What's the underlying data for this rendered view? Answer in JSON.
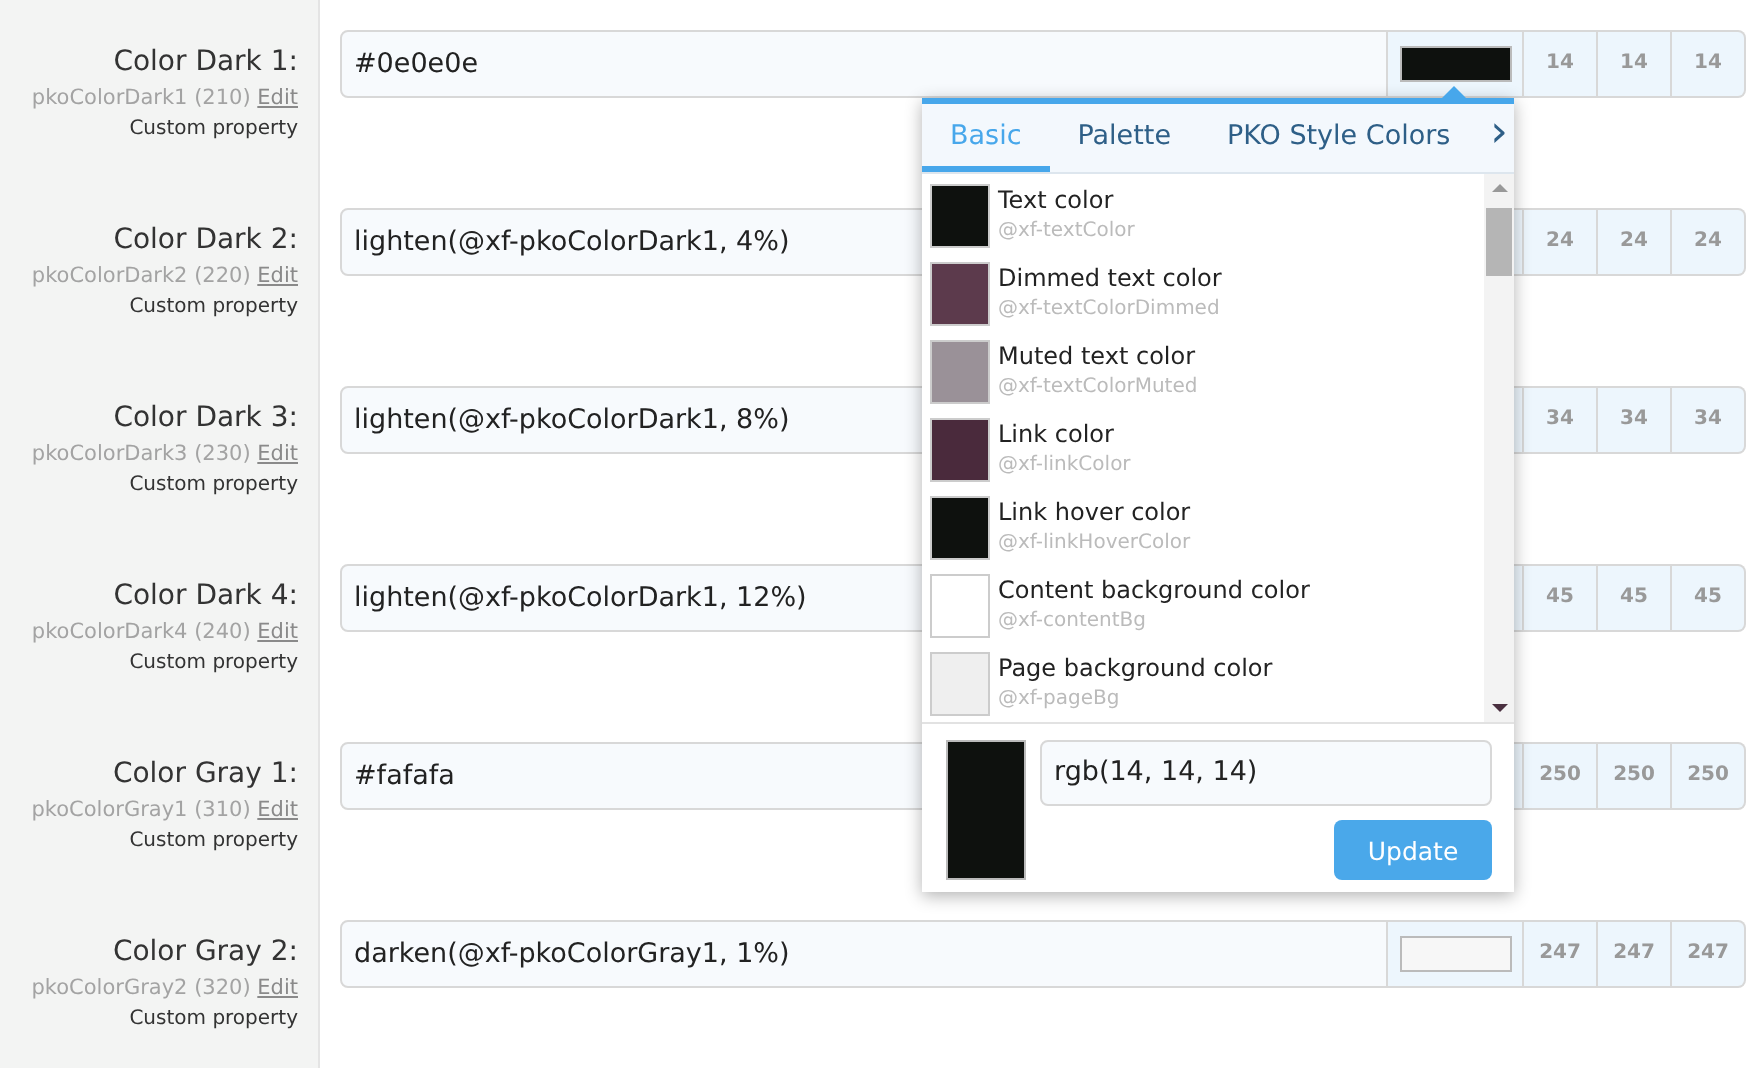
{
  "properties": [
    {
      "title": "Color Dark 1:",
      "name": "pkoColorDark1 (210)",
      "edit": "Edit",
      "note": "Custom property",
      "value": "#0e0e0e",
      "color": "#0e110e",
      "channels": [
        "14",
        "14",
        "14"
      ]
    },
    {
      "title": "Color Dark 2:",
      "name": "pkoColorDark2 (220)",
      "edit": "Edit",
      "note": "Custom property",
      "value": "lighten(@xf-pkoColorDark1, 4%)",
      "channels": [
        "24",
        "24",
        "24"
      ]
    },
    {
      "title": "Color Dark 3:",
      "name": "pkoColorDark3 (230)",
      "edit": "Edit",
      "note": "Custom property",
      "value": "lighten(@xf-pkoColorDark1, 8%)",
      "channels": [
        "34",
        "34",
        "34"
      ]
    },
    {
      "title": "Color Dark 4:",
      "name": "pkoColorDark4 (240)",
      "edit": "Edit",
      "note": "Custom property",
      "value": "lighten(@xf-pkoColorDark1, 12%)",
      "channels": [
        "45",
        "45",
        "45"
      ]
    },
    {
      "title": "Color Gray 1:",
      "name": "pkoColorGray1 (310)",
      "edit": "Edit",
      "note": "Custom property",
      "value": "#fafafa",
      "channels": [
        "250",
        "250",
        "250"
      ]
    },
    {
      "title": "Color Gray 2:",
      "name": "pkoColorGray2 (320)",
      "edit": "Edit",
      "note": "Custom property",
      "value": "darken(@xf-pkoColorGray1, 1%)",
      "color": "#f7f7f7",
      "channels": [
        "247",
        "247",
        "247"
      ]
    }
  ],
  "color_picker": {
    "tabs": [
      {
        "label": "Basic",
        "selected": true
      },
      {
        "label": "Palette",
        "selected": false
      },
      {
        "label": "PKO Style Colors",
        "selected": false
      }
    ],
    "more": "›",
    "colors": [
      {
        "label": "Text color",
        "variable": "@xf-textColor",
        "color": "#0e110e"
      },
      {
        "label": "Dimmed text color",
        "variable": "@xf-textColorDimmed",
        "color": "#5c3a4c"
      },
      {
        "label": "Muted text color",
        "variable": "@xf-textColorMuted",
        "color": "#9a9198"
      },
      {
        "label": "Link color",
        "variable": "@xf-linkColor",
        "color": "#4a2a3c"
      },
      {
        "label": "Link hover color",
        "variable": "@xf-linkHoverColor",
        "color": "#0e110e"
      },
      {
        "label": "Content background color",
        "variable": "@xf-contentBg",
        "color": "#ffffff"
      },
      {
        "label": "Page background color",
        "variable": "@xf-pageBg",
        "color": "#efefef"
      }
    ],
    "preview": {
      "color": "#0e110e"
    },
    "value": "rgb(14, 14, 14)",
    "button": "Update"
  }
}
